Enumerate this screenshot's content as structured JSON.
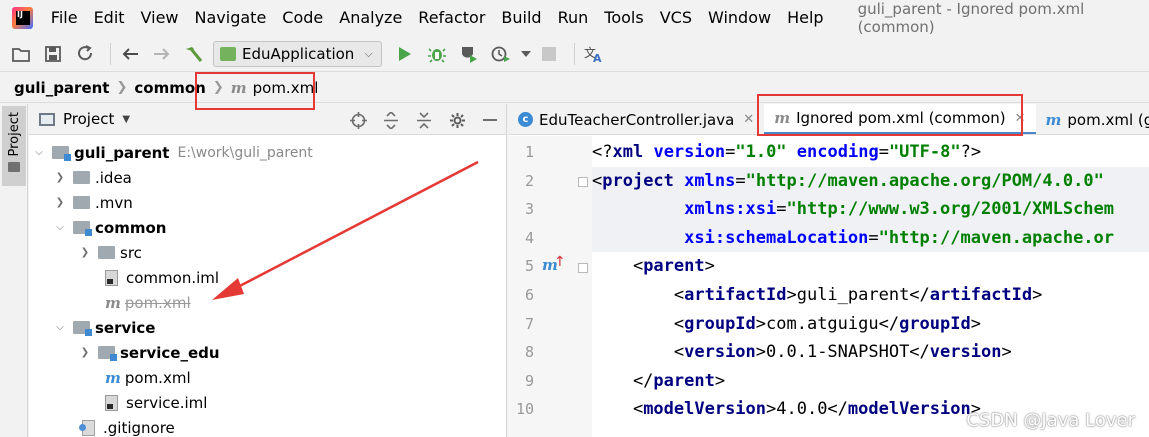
{
  "menubar": {
    "logo_text": "IJ",
    "items": [
      "File",
      "Edit",
      "View",
      "Navigate",
      "Code",
      "Analyze",
      "Refactor",
      "Build",
      "Run",
      "Tools",
      "VCS",
      "Window",
      "Help"
    ],
    "window_title": "guli_parent - Ignored pom.xml (common)"
  },
  "toolbar": {
    "run_config": "EduApplication",
    "icons": [
      "folder-open-icon",
      "save-icon",
      "sync-icon",
      "back-icon",
      "forward-icon",
      "build-hammer-icon",
      "run-config-selector",
      "run-icon",
      "debug-icon",
      "coverage-icon",
      "profile-icon",
      "stop-icon",
      "translate-icon"
    ]
  },
  "breadcrumb": {
    "items": [
      "guli_parent",
      "common"
    ],
    "file_icon": "m",
    "file": "pom.xml"
  },
  "stripe": {
    "project_label": "Project"
  },
  "project_panel": {
    "title": "Project",
    "rows": [
      {
        "name": "guli_parent",
        "path": "E:\\work\\guli_parent"
      },
      {
        "name": ".idea"
      },
      {
        "name": ".mvn"
      },
      {
        "name": "common"
      },
      {
        "name": "src"
      },
      {
        "name": "common.iml"
      },
      {
        "name": "pom.xml",
        "icon": "m"
      },
      {
        "name": "service"
      },
      {
        "name": "service_edu"
      },
      {
        "name": "pom.xml",
        "icon": "m"
      },
      {
        "name": "service.iml"
      },
      {
        "name": ".gitignore"
      }
    ]
  },
  "editor": {
    "tabs": [
      {
        "label": "EduTeacherController.java",
        "icon": "c"
      },
      {
        "label": "Ignored pom.xml (common)",
        "icon": "m"
      },
      {
        "label": "pom.xml (gu",
        "icon": "m"
      }
    ],
    "line_numbers": [
      "1",
      "2",
      "3",
      "4",
      "5",
      "6",
      "7",
      "8",
      "9",
      "10"
    ],
    "gutter_mark": "m",
    "gutter_arrow": "↑",
    "code": [
      [
        [
          "plain",
          "<?"
        ],
        [
          "tag",
          "xml"
        ],
        [
          "plain",
          " "
        ],
        [
          "attr",
          "version"
        ],
        [
          "plain",
          "="
        ],
        [
          "str",
          "\"1.0\""
        ],
        [
          "plain",
          " "
        ],
        [
          "attr",
          "encoding"
        ],
        [
          "plain",
          "="
        ],
        [
          "str",
          "\"UTF-8\""
        ],
        [
          "plain",
          "?>"
        ]
      ],
      [
        [
          "plain",
          "<"
        ],
        [
          "tag",
          "project"
        ],
        [
          "plain",
          " "
        ],
        [
          "attr",
          "xmlns"
        ],
        [
          "plain",
          "="
        ],
        [
          "str",
          "\"http://maven.apache.org/POM/4.0.0\""
        ]
      ],
      [
        [
          "plain",
          "         "
        ],
        [
          "attr",
          "xmlns:xsi"
        ],
        [
          "plain",
          "="
        ],
        [
          "str",
          "\"http://www.w3.org/2001/XMLSchem"
        ]
      ],
      [
        [
          "plain",
          "         "
        ],
        [
          "attr",
          "xsi:schemaLocation"
        ],
        [
          "plain",
          "="
        ],
        [
          "str",
          "\"http://maven.apache.or"
        ]
      ],
      [
        [
          "plain",
          "    <"
        ],
        [
          "tag",
          "parent"
        ],
        [
          "plain",
          ">"
        ]
      ],
      [
        [
          "plain",
          "        <"
        ],
        [
          "tag",
          "artifactId"
        ],
        [
          "plain",
          ">guli_parent</"
        ],
        [
          "tag",
          "artifactId"
        ],
        [
          "plain",
          ">"
        ]
      ],
      [
        [
          "plain",
          "        <"
        ],
        [
          "tag",
          "groupId"
        ],
        [
          "plain",
          ">com.atguigu</"
        ],
        [
          "tag",
          "groupId"
        ],
        [
          "plain",
          ">"
        ]
      ],
      [
        [
          "plain",
          "        <"
        ],
        [
          "tag",
          "version"
        ],
        [
          "plain",
          ">0.0.1-SNAPSHOT</"
        ],
        [
          "tag",
          "version"
        ],
        [
          "plain",
          ">"
        ]
      ],
      [
        [
          "plain",
          "    </"
        ],
        [
          "tag",
          "parent"
        ],
        [
          "plain",
          ">"
        ]
      ],
      [
        [
          "plain",
          "    <"
        ],
        [
          "tag",
          "modelVersion"
        ],
        [
          "plain",
          ">4.0.0</"
        ],
        [
          "tag",
          "modelVersion"
        ],
        [
          "plain",
          ">"
        ]
      ]
    ]
  },
  "watermark": "CSDN @Java Lover",
  "colors": {
    "annotation_red": "#e53935",
    "tab_active_underline": "#4a88c7",
    "xml_tag": "#000080",
    "xml_attr": "#0000ff",
    "xml_string": "#008000"
  }
}
